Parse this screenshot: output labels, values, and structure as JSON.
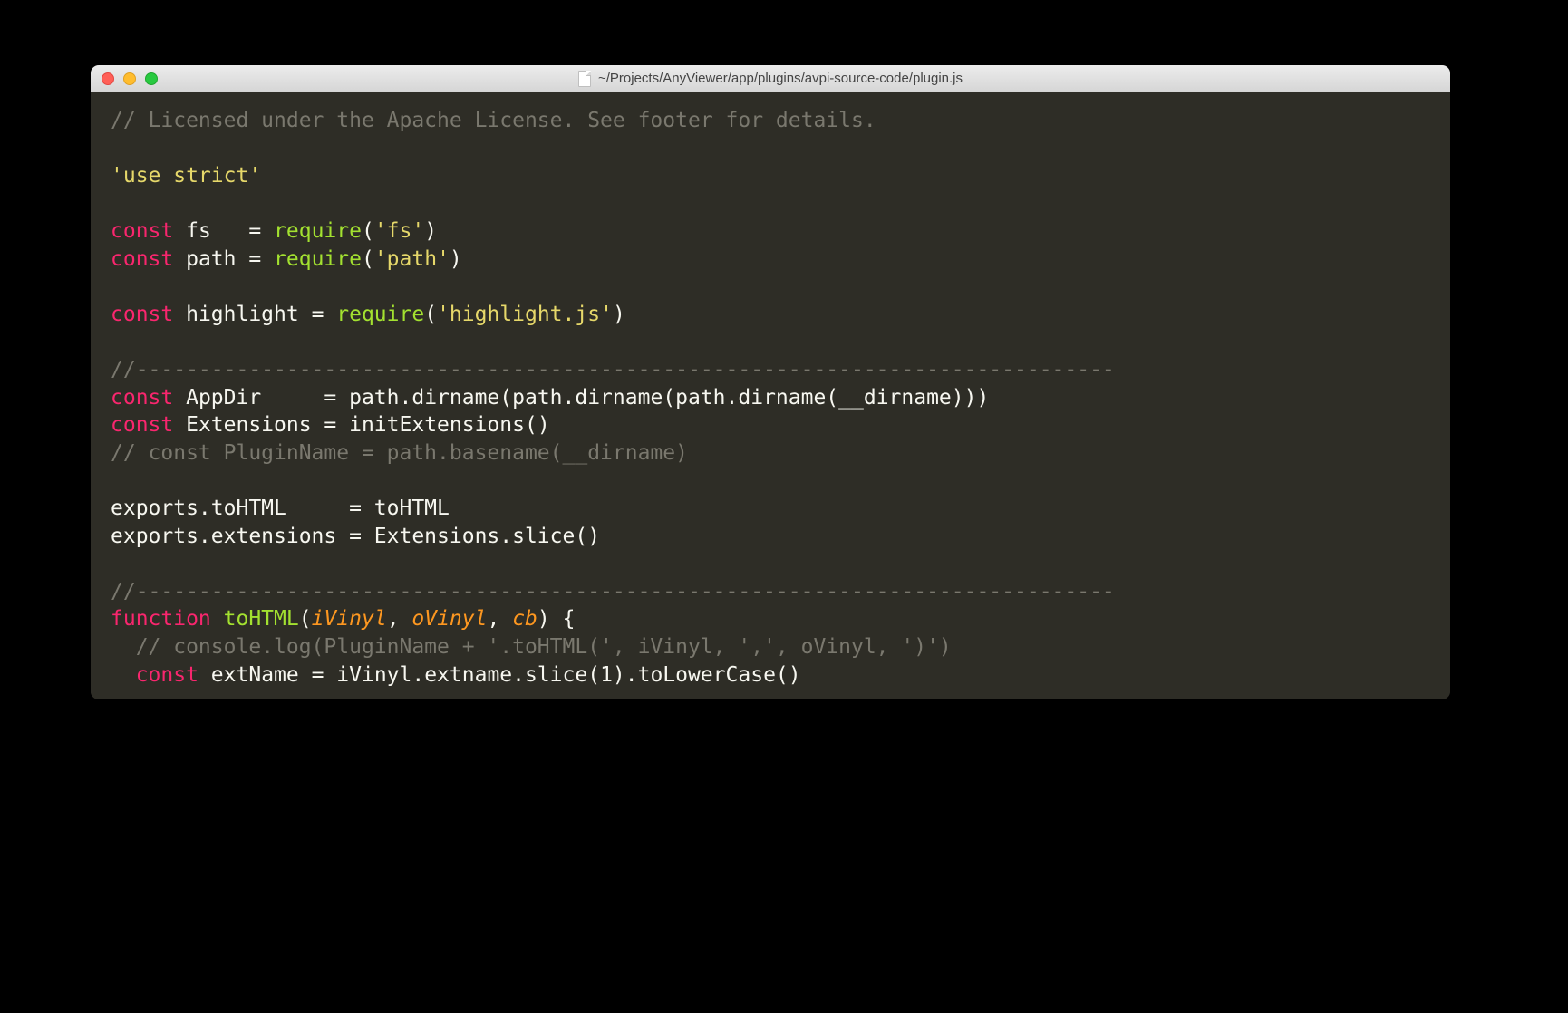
{
  "window": {
    "title": "~/Projects/AnyViewer/app/plugins/avpi-source-code/plugin.js"
  },
  "code": {
    "l1_comment": "// Licensed under the Apache License. See footer for details.",
    "l3_string": "'use strict'",
    "l5_kw": "const",
    "l5_ident": " fs   = ",
    "l5_call": "require",
    "l5_paren_open": "(",
    "l5_arg": "'fs'",
    "l5_paren_close": ")",
    "l6_kw": "const",
    "l6_ident": " path = ",
    "l6_call": "require",
    "l6_paren_open": "(",
    "l6_arg": "'path'",
    "l6_paren_close": ")",
    "l8_kw": "const",
    "l8_ident": " highlight = ",
    "l8_call": "require",
    "l8_paren_open": "(",
    "l8_arg": "'highlight.js'",
    "l8_paren_close": ")",
    "l10_comment": "//------------------------------------------------------------------------------",
    "l11_kw": "const",
    "l11_rest": " AppDir     = path.dirname(path.dirname(path.dirname(__dirname)))",
    "l12_kw": "const",
    "l12_rest": " Extensions = initExtensions()",
    "l13_comment": "// const PluginName = path.basename(__dirname)",
    "l15": "exports.toHTML     = toHTML",
    "l16": "exports.extensions = Extensions.slice()",
    "l18_comment": "//------------------------------------------------------------------------------",
    "l19_kw": "function",
    "l19_space": " ",
    "l19_name": "toHTML",
    "l19_paren_open": "(",
    "l19_arg1": "iVinyl",
    "l19_comma1": ", ",
    "l19_arg2": "oVinyl",
    "l19_comma2": ", ",
    "l19_arg3": "cb",
    "l19_paren_close_brace": ") {",
    "l20_comment": "  // console.log(PluginName + '.toHTML(', iVinyl, ',', oVinyl, ')')",
    "l21_indent": "  ",
    "l21_kw": "const",
    "l21_rest": " extName = iVinyl.extname.slice(1).toLowerCase()"
  }
}
